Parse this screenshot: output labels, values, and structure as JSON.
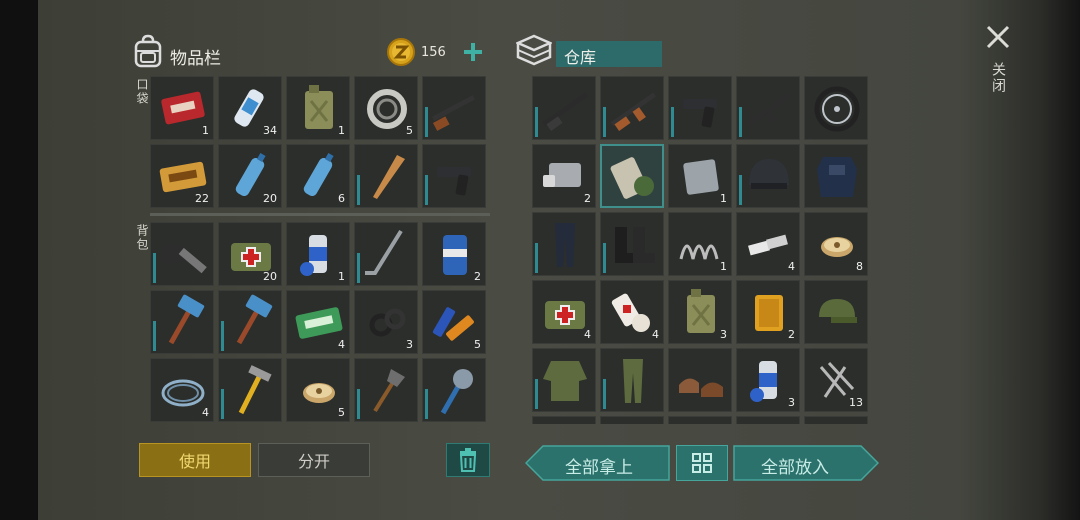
{
  "inventory": {
    "title": "物品栏",
    "coins": "156",
    "pocket_label": "口袋",
    "backpack_label": "背包",
    "pockets": [
      {
        "icon": "coupon-red-icon",
        "count": "1"
      },
      {
        "icon": "spray-can-icon",
        "count": "34"
      },
      {
        "icon": "jerrycan-icon",
        "count": "1"
      },
      {
        "icon": "bearing-icon",
        "count": "5"
      },
      {
        "icon": "shotgun-icon",
        "count": ""
      },
      {
        "icon": "coupon-gold-icon",
        "count": "22"
      },
      {
        "icon": "water-bottle-icon",
        "count": "20"
      },
      {
        "icon": "water-bottle-icon",
        "count": "6"
      },
      {
        "icon": "baseball-bat-icon",
        "count": ""
      },
      {
        "icon": "pistol-icon",
        "count": ""
      }
    ],
    "backpack": [
      {
        "icon": "chainsaw-icon",
        "count": ""
      },
      {
        "icon": "medkit-bag-icon",
        "count": "20"
      },
      {
        "icon": "paint-spray-icon",
        "count": "1"
      },
      {
        "icon": "hockey-stick-icon",
        "count": ""
      },
      {
        "icon": "beer-can-icon",
        "count": "2"
      },
      {
        "icon": "sledgehammer-icon",
        "count": ""
      },
      {
        "icon": "sledgehammer-icon",
        "count": ""
      },
      {
        "icon": "ration-coupon-icon",
        "count": "4"
      },
      {
        "icon": "rubber-rings-icon",
        "count": "3"
      },
      {
        "icon": "batteries-icon",
        "count": "5"
      },
      {
        "icon": "wire-coil-icon",
        "count": "4"
      },
      {
        "icon": "hammer-icon",
        "count": ""
      },
      {
        "icon": "thread-spool-icon",
        "count": "5"
      },
      {
        "icon": "shovel-icon",
        "count": ""
      },
      {
        "icon": "saw-mace-icon",
        "count": ""
      }
    ],
    "use_label": "使用",
    "split_label": "分开"
  },
  "storage": {
    "title": "仓库",
    "items": [
      {
        "icon": "rifle-icon",
        "count": ""
      },
      {
        "icon": "ak-rifle-icon",
        "count": ""
      },
      {
        "icon": "pistol-icon",
        "count": ""
      },
      {
        "icon": "assault-rifle-icon",
        "count": ""
      },
      {
        "icon": "wheel-icon",
        "count": ""
      },
      {
        "icon": "engine-block-icon",
        "count": "2"
      },
      {
        "icon": "canned-food-icon",
        "count": ""
      },
      {
        "icon": "metal-plate-icon",
        "count": "1"
      },
      {
        "icon": "helmet-icon",
        "count": ""
      },
      {
        "icon": "body-armor-icon",
        "count": ""
      },
      {
        "icon": "pants-icon",
        "count": ""
      },
      {
        "icon": "boots-icon",
        "count": ""
      },
      {
        "icon": "spring-icon",
        "count": "1"
      },
      {
        "icon": "aluminum-bars-icon",
        "count": "4"
      },
      {
        "icon": "thread-spool-icon",
        "count": "8"
      },
      {
        "icon": "medkit-bag-icon",
        "count": "4"
      },
      {
        "icon": "bandage-icon",
        "count": "4"
      },
      {
        "icon": "jerrycan-icon",
        "count": "3"
      },
      {
        "icon": "oil-filter-icon",
        "count": "2"
      },
      {
        "icon": "camo-cap-icon",
        "count": ""
      },
      {
        "icon": "camo-jacket-icon",
        "count": ""
      },
      {
        "icon": "camo-pants-icon",
        "count": ""
      },
      {
        "icon": "shoes-icon",
        "count": ""
      },
      {
        "icon": "paint-spray-icon",
        "count": "3"
      },
      {
        "icon": "nails-icon",
        "count": "13"
      }
    ],
    "take_all_label": "全部拿上",
    "put_all_label": "全部放入"
  },
  "close_label": "关闭"
}
